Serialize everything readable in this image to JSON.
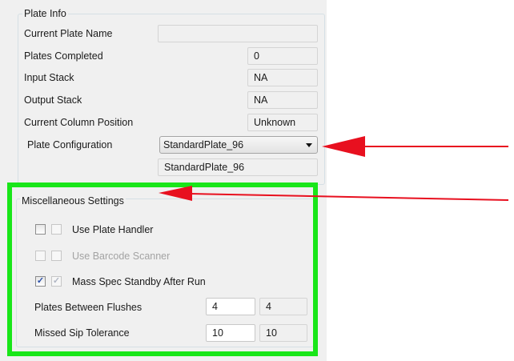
{
  "plate_info": {
    "title": "Plate Info",
    "current_plate_name": {
      "label": "Current Plate Name",
      "value": ""
    },
    "plates_completed": {
      "label": "Plates Completed",
      "value": "0"
    },
    "input_stack": {
      "label": "Input Stack",
      "value": "NA"
    },
    "output_stack": {
      "label": "Output Stack",
      "value": "NA"
    },
    "current_column_position": {
      "label": "Current Column Position",
      "value": "Unknown"
    },
    "plate_configuration": {
      "label": "Plate Configuration",
      "selected": "StandardPlate_96",
      "current": "StandardPlate_96"
    }
  },
  "misc": {
    "title": "Miscellaneous Settings",
    "use_plate_handler": {
      "label": "Use Plate Handler",
      "checked": false,
      "enabled": true
    },
    "use_barcode_scanner": {
      "label": "Use Barcode Scanner",
      "checked": false,
      "enabled": false
    },
    "mass_spec_standby": {
      "label": "Mass Spec Standby After Run",
      "checked": true,
      "enabled": true
    },
    "plates_between_flushes": {
      "label": "Plates Between Flushes",
      "value": "4",
      "current": "4"
    },
    "missed_sip_tolerance": {
      "label": "Missed Sip Tolerance",
      "value": "10",
      "current": "10"
    }
  },
  "annotations": {
    "highlight_color": "#19e619",
    "arrow_color": "#e8101f",
    "check_mark": "✓"
  }
}
